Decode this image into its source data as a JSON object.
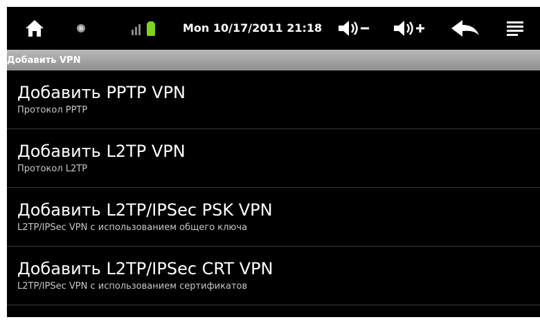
{
  "statusbar": {
    "datetime": "Mon 10/17/2011 21:18",
    "icons": [
      "home-icon",
      "notification-dot-icon",
      "signal-icon",
      "battery-icon",
      "volume-down-icon",
      "volume-up-icon",
      "back-icon",
      "menu-icon"
    ]
  },
  "title": "Добавить VPN",
  "items": [
    {
      "title": "Добавить PPTP VPN",
      "subtitle": "Протокол PPTP"
    },
    {
      "title": "Добавить L2TP VPN",
      "subtitle": "Протокол L2TP"
    },
    {
      "title": "Добавить L2TP/IPSec PSK VPN",
      "subtitle": "L2TP/IPSec VPN с использованием общего ключа"
    },
    {
      "title": "Добавить L2TP/IPSec CRT VPN",
      "subtitle": "L2TP/IPSec VPN с использованием сертификатов"
    }
  ],
  "colors": {
    "background": "#000000",
    "titlebar": "#a9a9a9",
    "battery": "#7ed321"
  }
}
